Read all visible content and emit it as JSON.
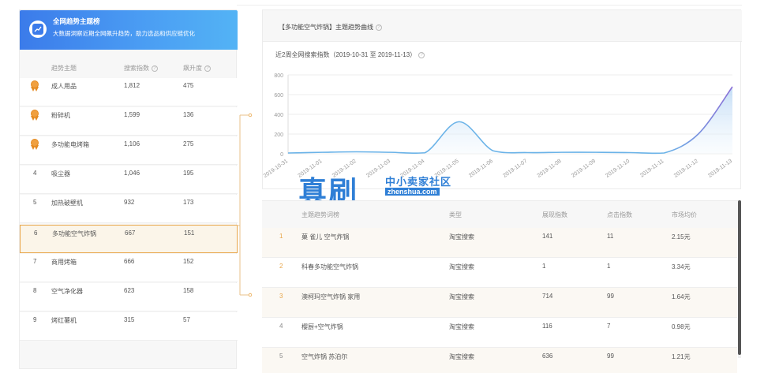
{
  "left_panel": {
    "banner_title": "全网趋势主题榜",
    "banner_subtitle": "大数据洞察近期全网飙升趋势，助力选品和供应链优化",
    "columns": [
      "趋势主题",
      "搜索指数",
      "飙升度"
    ],
    "rows": [
      {
        "rank": "1",
        "medal": true,
        "name": "成人用品",
        "search": "1,812",
        "rise": "475"
      },
      {
        "rank": "2",
        "medal": true,
        "name": "粉碎机",
        "search": "1,599",
        "rise": "136"
      },
      {
        "rank": "3",
        "medal": true,
        "name": "多功能电烤箱",
        "search": "1,106",
        "rise": "275"
      },
      {
        "rank": "4",
        "medal": false,
        "name": "吸尘器",
        "search": "1,046",
        "rise": "195"
      },
      {
        "rank": "5",
        "medal": false,
        "name": "加热破壁机",
        "search": "932",
        "rise": "173"
      },
      {
        "rank": "6",
        "medal": false,
        "name": "多功能空气炸锅",
        "search": "667",
        "rise": "151",
        "selected": true
      },
      {
        "rank": "7",
        "medal": false,
        "name": "商用烤箱",
        "search": "666",
        "rise": "152"
      },
      {
        "rank": "8",
        "medal": false,
        "name": "空气净化器",
        "search": "623",
        "rise": "158"
      },
      {
        "rank": "9",
        "medal": false,
        "name": "烤红薯机",
        "search": "315",
        "rise": "57"
      }
    ]
  },
  "right_panel": {
    "title": "【多功能空气炸锅】主题趋势曲线",
    "chart_subtitle": "近2周全网搜索指数（2019-10-31 至 2019-11-13）"
  },
  "chart_data": {
    "type": "area",
    "x": [
      "2019-10-31",
      "2019-11-01",
      "2019-11-02",
      "2019-11-03",
      "2019-11-04",
      "2019-11-05",
      "2019-11-06",
      "2019-11-07",
      "2019-11-08",
      "2019-11-09",
      "2019-11-10",
      "2019-11-11",
      "2019-11-12",
      "2019-11-13"
    ],
    "values": [
      8,
      15,
      20,
      15,
      10,
      325,
      30,
      12,
      15,
      15,
      12,
      8,
      200,
      680
    ],
    "yticks": [
      0,
      200,
      400,
      600,
      800
    ],
    "ylim": [
      0,
      800
    ],
    "grid": true,
    "line_color": "#6bb3e8"
  },
  "keyword_table": {
    "columns": [
      "主题趋势词榜",
      "类型",
      "展现指数",
      "点击指数",
      "市场均价"
    ],
    "rows": [
      {
        "rank": "1",
        "word": "菓 雀儿 空气炸锅",
        "type": "淘宝搜索",
        "show": "141",
        "click": "11",
        "price": "2.15元"
      },
      {
        "rank": "2",
        "word": "科春多功能空气炸锅",
        "type": "淘宝搜索",
        "show": "1",
        "click": "1",
        "price": "3.34元"
      },
      {
        "rank": "3",
        "word": "澳柯玛空气炸锅 家用",
        "type": "淘宝搜索",
        "show": "714",
        "click": "99",
        "price": "1.64元"
      },
      {
        "rank": "4",
        "word": "樱厨+空气炸锅",
        "type": "淘宝搜索",
        "show": "116",
        "click": "7",
        "price": "0.98元"
      },
      {
        "rank": "5",
        "word": "空气炸锅 苏泊尔",
        "type": "淘宝搜索",
        "show": "636",
        "click": "99",
        "price": "1.21元"
      }
    ]
  },
  "watermark": {
    "big": "真刷",
    "cn": "中小卖家社区",
    "en": "zhenshua.com"
  }
}
